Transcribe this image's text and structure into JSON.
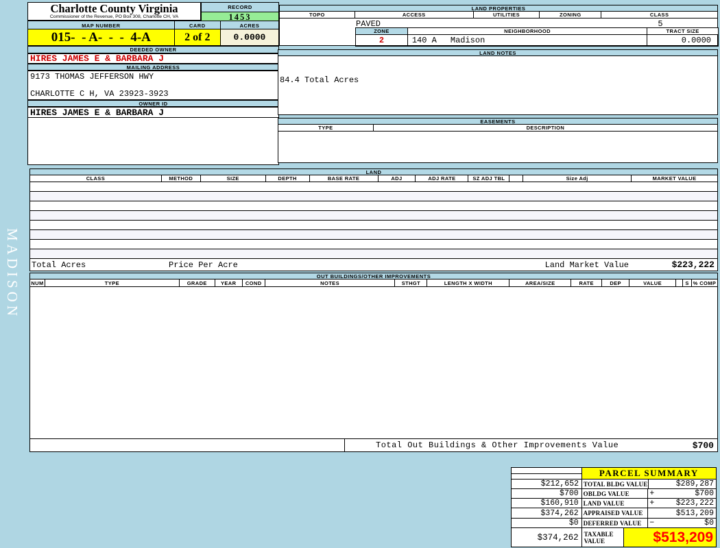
{
  "colors": {
    "page_bg": "#AFD6E3",
    "header_bar_bg": "#B3D9E6",
    "record_green": "#96EC96",
    "highlight_yellow": "#FFFF00",
    "acres_cream": "#F5F2DA",
    "owner_red": "#CC0000",
    "taxable_red": "#FF0000"
  },
  "sidebar": {
    "district_label": "MADISON"
  },
  "header": {
    "county_title": "Charlotte County Virginia",
    "county_subtitle": "Commissioner of the Revenue, PO Box 308, Charlotte CH, VA",
    "record_label": "RECORD",
    "record_value": "1453",
    "map_number_label": "MAP NUMBER",
    "map_number_value": "015-  - A-  -  -  4-A",
    "card_label": "CARD",
    "card_value": "2 of 2",
    "acres_label": "ACRES",
    "acres_value": "0.0000"
  },
  "owner": {
    "deeded_owner_label": "DEEDED OWNER",
    "deeded_owner": "HIRES JAMES E & BARBARA J",
    "mailing_address_label": "MAILING ADDRESS",
    "address_line1": "9173 THOMAS JEFFERSON HWY",
    "address_line2": "CHARLOTTE C H, VA 23923-3923",
    "owner_id_label": "OWNER ID",
    "owner_id": "HIRES JAMES E & BARBARA J"
  },
  "land_properties": {
    "title": "LAND PROPERTIES",
    "headers": [
      "TOPO",
      "ACCESS",
      "UTILITIES",
      "ZONING",
      "CLASS"
    ],
    "topo": "",
    "access": "PAVED",
    "utilities": "",
    "zoning": "",
    "class": "5",
    "zone_label": "ZONE",
    "zone": "2",
    "neighborhood_label": "NEIGHBORHOOD",
    "neighborhood_code": "140 A",
    "neighborhood_name": "Madison",
    "tract_size_label": "TRACT SIZE",
    "tract_size": "0.0000"
  },
  "land_notes": {
    "title": "LAND NOTES",
    "note": "84.4 Total Acres"
  },
  "easements": {
    "title": "EASEMENTS",
    "headers": [
      "TYPE",
      "DESCRIPTION"
    ],
    "rows": []
  },
  "land": {
    "title": "LAND",
    "headers": [
      "CLASS",
      "METHOD",
      "SIZE",
      "DEPTH",
      "BASE RATE",
      "ADJ",
      "ADJ RATE",
      "SZ ADJ TBL",
      "",
      "Size Adj",
      "MARKET VALUE"
    ],
    "rows": [],
    "total_acres_label": "Total Acres",
    "price_per_acre_label": "Price Per Acre",
    "land_market_value_label": "Land Market Value",
    "land_market_value": "$223,222"
  },
  "out_buildings": {
    "title": "OUT BUILDINGS/OTHER IMPROVEMENTS",
    "headers": [
      "NUM",
      "TYPE",
      "GRADE",
      "YEAR",
      "COND",
      "NOTES",
      "STHGT",
      "LENGTH X WIDTH",
      "AREA/SIZE",
      "RATE",
      "DEP",
      "VALUE",
      "",
      "S",
      "% COMP"
    ],
    "rows": [],
    "total_label": "Total Out Buildings & Other Improvements Value",
    "total_value": "$700"
  },
  "parcel_summary": {
    "title": "PARCEL SUMMARY",
    "rows": [
      {
        "prior": "$212,652",
        "label": "TOTAL BLDG VALUE",
        "op": "",
        "value": "$289,287"
      },
      {
        "prior": "$700",
        "label": "OBLDG VALUE",
        "op": "+",
        "value": "$700"
      },
      {
        "prior": "$160,910",
        "label": "LAND VALUE",
        "op": "+",
        "value": "$223,222"
      },
      {
        "prior": "$374,262",
        "label": "APPRAISED VALUE",
        "op": "",
        "value": "$513,209"
      },
      {
        "prior": "$0",
        "label": "DEFERRED VALUE",
        "op": "−",
        "value": "$0"
      }
    ],
    "taxable": {
      "prior": "$374,262",
      "label": "TAXABLE VALUE",
      "value": "$513,209"
    }
  }
}
